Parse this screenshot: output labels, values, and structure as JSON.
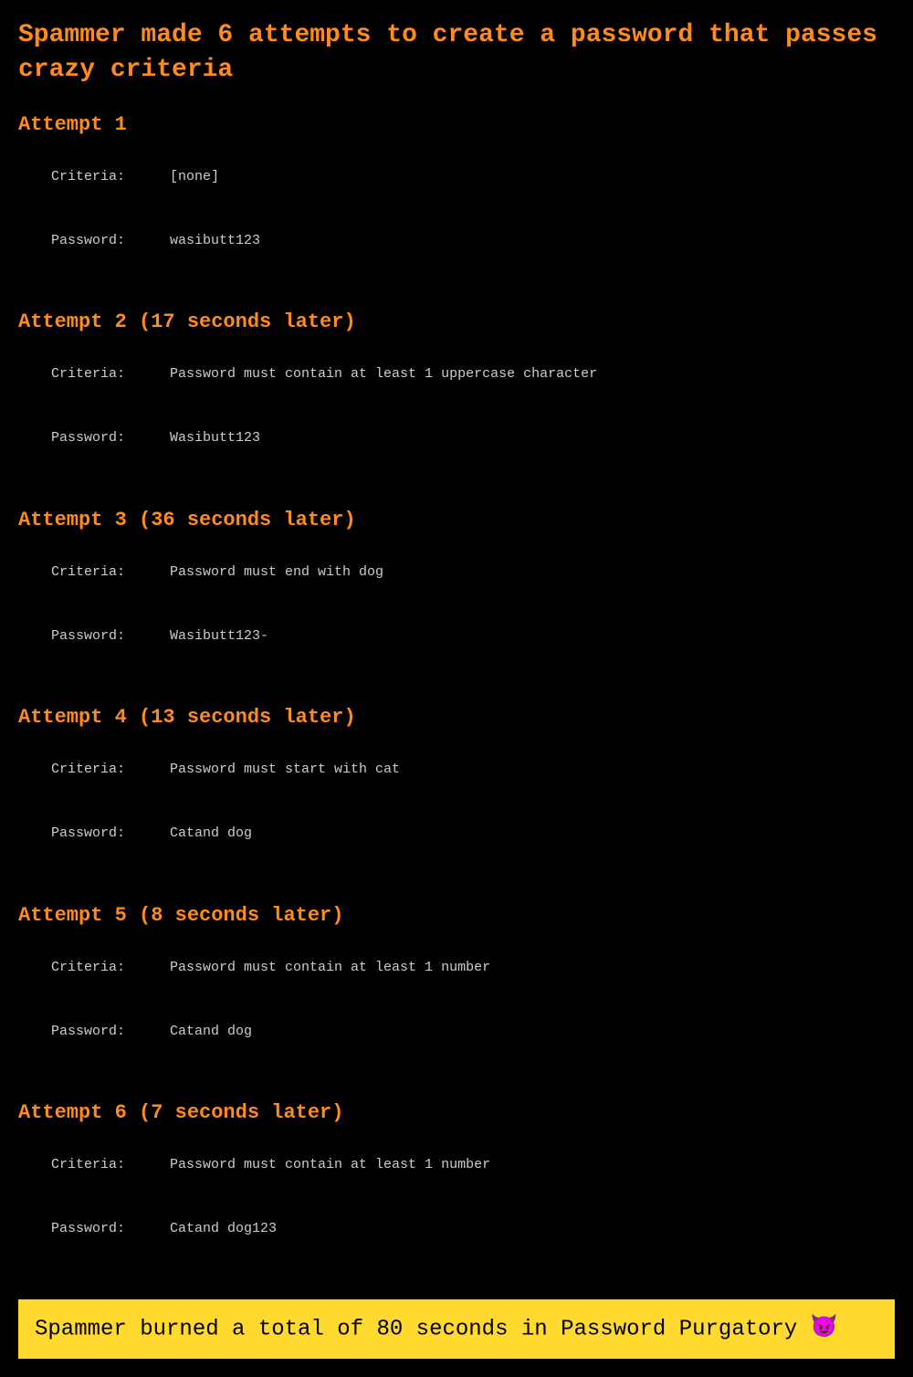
{
  "title": "Spammer made 6 attempts to create a password that passes crazy criteria",
  "labels": {
    "criteria": "Criteria:",
    "password": "Password:"
  },
  "attempts": [
    {
      "heading": "Attempt 1",
      "criteria": "[none]",
      "password": "wasibutt123"
    },
    {
      "heading": "Attempt 2 (17 seconds later)",
      "criteria": "Password must contain at least 1 uppercase character",
      "password": "Wasibutt123"
    },
    {
      "heading": "Attempt 3 (36 seconds later)",
      "criteria": "Password must end with dog",
      "password": "Wasibutt123-"
    },
    {
      "heading": "Attempt 4 (13 seconds later)",
      "criteria": "Password must start with cat",
      "password": "Catand dog"
    },
    {
      "heading": "Attempt 5 (8 seconds later)",
      "criteria": "Password must contain at least 1 number",
      "password": "Catand dog"
    },
    {
      "heading": "Attempt 6 (7 seconds later)",
      "criteria": "Password must contain at least 1 number",
      "password": "Catand dog123"
    }
  ],
  "summary": {
    "text": "Spammer burned a total of 80 seconds in Password Purgatory ",
    "emoji": "😈"
  }
}
